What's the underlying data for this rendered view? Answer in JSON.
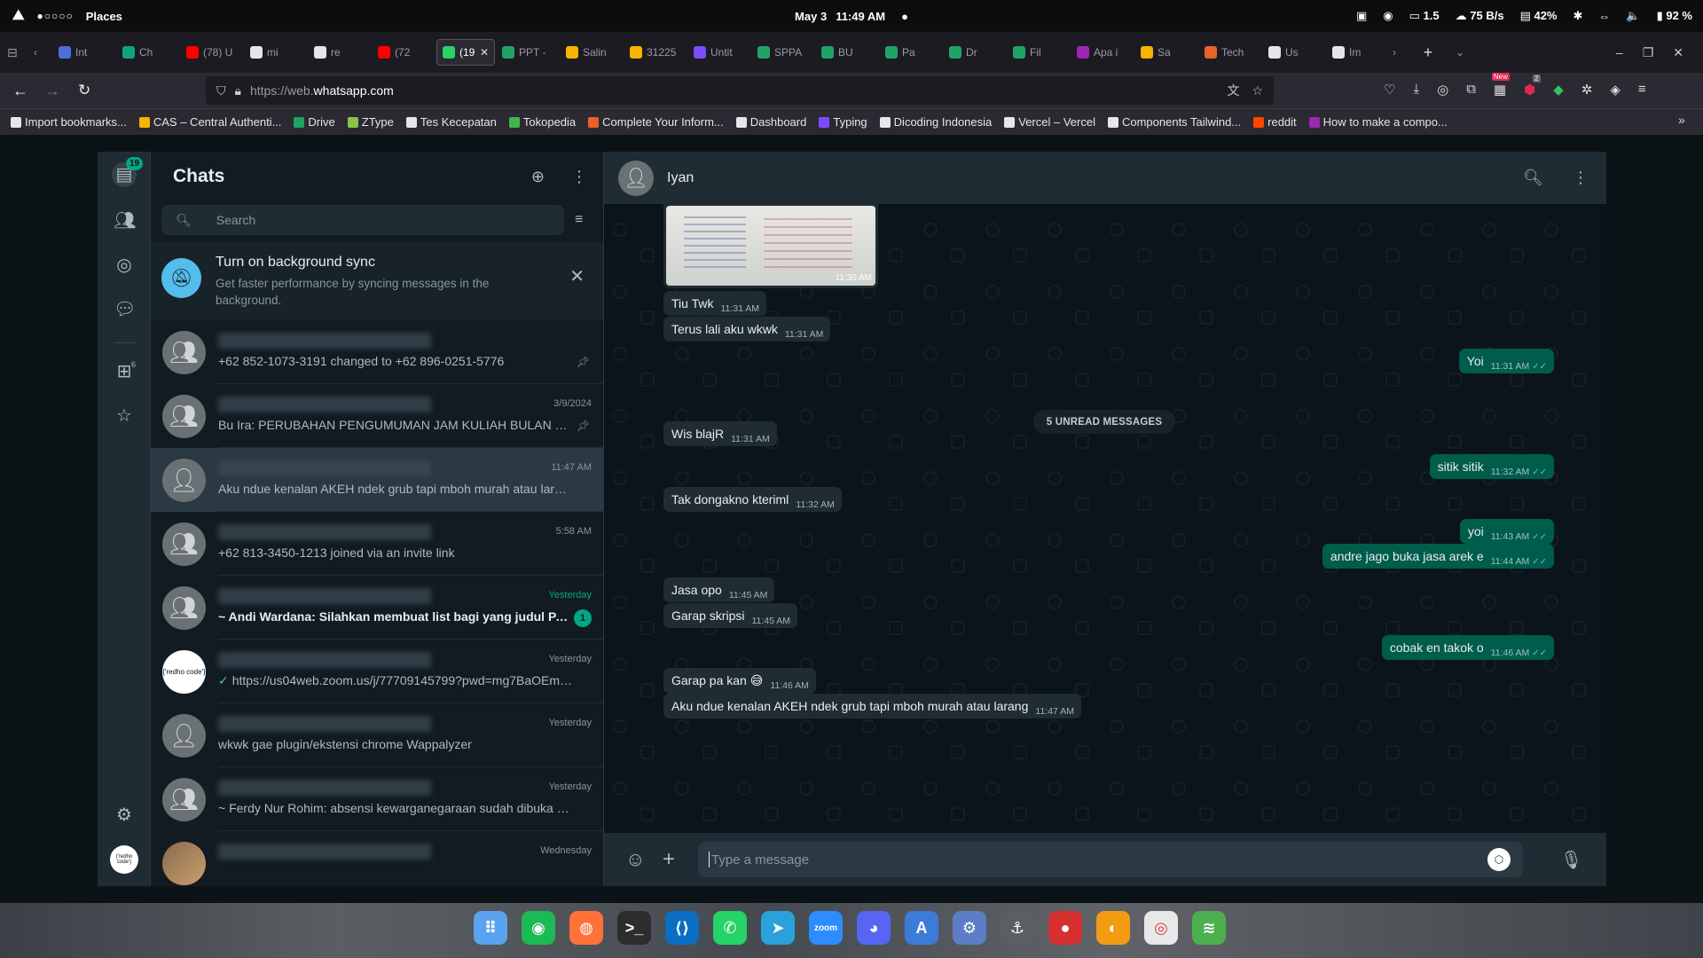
{
  "topbar": {
    "places": "Places",
    "date": "May 3",
    "time": "11:49 AM",
    "load": "1.5",
    "net": "75 B/s",
    "battery": "42%",
    "volume_level": "92 %"
  },
  "tabs": [
    {
      "label": "Int",
      "color": "#4a6fd8"
    },
    {
      "label": "Ch",
      "color": "#10a37f"
    },
    {
      "label": "(78) U",
      "color": "#ff0000"
    },
    {
      "label": "mi",
      "color": "#e6e6e6"
    },
    {
      "label": "re",
      "color": "#e6e6e6"
    },
    {
      "label": "(72",
      "color": "#ff0000"
    },
    {
      "label": "(19",
      "color": "#25d366"
    },
    {
      "label": "PPT -",
      "color": "#1fa463"
    },
    {
      "label": "Salin",
      "color": "#f4b400"
    },
    {
      "label": "31225",
      "color": "#f4b400"
    },
    {
      "label": "Untit",
      "color": "#7c4dff"
    },
    {
      "label": "SPPA",
      "color": "#1fa463"
    },
    {
      "label": "BU",
      "color": "#1fa463"
    },
    {
      "label": "Pa",
      "color": "#1fa463"
    },
    {
      "label": "Dr",
      "color": "#1fa463"
    },
    {
      "label": "Fil",
      "color": "#1fa463"
    },
    {
      "label": "Apa i",
      "color": "#9c27b0"
    },
    {
      "label": "Sa",
      "color": "#f4b400"
    },
    {
      "label": "Tech",
      "color": "#e8622a"
    },
    {
      "label": "Us",
      "color": "#e6e6e6"
    },
    {
      "label": "Im",
      "color": "#e6e6e6"
    }
  ],
  "url": {
    "prefix": "https://web.",
    "domain": "whatsapp.com",
    "badge_new": "New",
    "badge_count": "2"
  },
  "bookmarks": [
    {
      "label": "Import bookmarks...",
      "color": "#e6e6e6"
    },
    {
      "label": "CAS – Central Authenti...",
      "color": "#f4b400"
    },
    {
      "label": "Drive",
      "color": "#1fa463"
    },
    {
      "label": "ZType",
      "color": "#8bc34a"
    },
    {
      "label": "Tes Kecepatan",
      "color": "#e6e6e6"
    },
    {
      "label": "Tokopedia",
      "color": "#42b549"
    },
    {
      "label": "Complete Your Inform...",
      "color": "#e8622a"
    },
    {
      "label": "Dashboard",
      "color": "#e6e6e6"
    },
    {
      "label": "Typing",
      "color": "#7c4dff"
    },
    {
      "label": "Dicoding Indonesia",
      "color": "#e6e6e6"
    },
    {
      "label": "Vercel – Vercel",
      "color": "#e6e6e6"
    },
    {
      "label": "Components Tailwind...",
      "color": "#e6e6e6"
    },
    {
      "label": "reddit",
      "color": "#ff4500"
    },
    {
      "label": "How to make a compo...",
      "color": "#9c27b0"
    }
  ],
  "rail": {
    "chats_badge": "19",
    "communities_badge": "6"
  },
  "sidebar": {
    "title": "Chats",
    "search_placeholder": "Search",
    "sync": {
      "title": "Turn on background sync",
      "desc": "Get faster performance by syncing messages in the background."
    },
    "chats": [
      {
        "time": "",
        "msg": "+62 852-1073-3191 changed to +62 896-0251-5776",
        "avatar": "group"
      },
      {
        "time": "3/9/2024",
        "msg": "Bu Ira: PERUBAHAN PENGUMUMAN JAM KULIAH BULAN RAM...",
        "avatar": "group"
      },
      {
        "time": "11:47 AM",
        "msg": "Aku ndue kenalan AKEH ndek grub tapi mboh murah atau larang",
        "avatar": "person"
      },
      {
        "time": "5:58 AM",
        "msg": "+62 813-3450-1213 joined via an invite link",
        "avatar": "group"
      },
      {
        "time": "Yesterday",
        "msg": "~ Andi Wardana: Silahkan membuat list bagi yang judul PA s...",
        "avatar": "group",
        "unread": "1"
      },
      {
        "time": "Yesterday",
        "msg": "https://us04web.zoom.us/j/77709145799?pwd=mg7BaOEmXD...",
        "avatar": "logo",
        "logo_text": "{'redho code'}"
      },
      {
        "time": "Yesterday",
        "msg": "wkwk gae plugin/ekstensi chrome  Wappalyzer",
        "avatar": "person"
      },
      {
        "time": "Yesterday",
        "msg": "~ Ferdy Nur Rohim: absensi kewarganegaraan sudah dibuka ya t...",
        "avatar": "group"
      },
      {
        "time": "Wednesday",
        "msg": "",
        "avatar": "photo"
      }
    ]
  },
  "chat": {
    "name": "Iyan",
    "unread_divider": "5 UNREAD MESSAGES",
    "image_time": "11:30 AM",
    "compose_placeholder": "Type a message",
    "messages": [
      {
        "dir": "in",
        "text": "Tiu Twk",
        "time": "11:31 AM"
      },
      {
        "dir": "in",
        "text": "Terus lali aku wkwk",
        "time": "11:31 AM"
      },
      {
        "dir": "out",
        "text": "Yoi",
        "time": "11:31 AM"
      },
      {
        "dir": "in",
        "text": "Wis blajR",
        "time": "11:31 AM"
      },
      {
        "dir": "out",
        "text": "sitik sitik",
        "time": "11:32 AM"
      },
      {
        "dir": "in",
        "text": "Tak dongakno kteriml",
        "time": "11:32 AM"
      },
      {
        "dir": "out",
        "text": "yoi",
        "time": "11:43 AM"
      },
      {
        "dir": "out",
        "text": "andre jago buka jasa arek e",
        "time": "11:44 AM"
      },
      {
        "dir": "in",
        "text": "Jasa opo",
        "time": "11:45 AM"
      },
      {
        "dir": "in",
        "text": "Garap skripsi",
        "time": "11:45 AM"
      },
      {
        "dir": "out",
        "text": "cobak en takok o",
        "time": "11:46 AM"
      },
      {
        "dir": "in",
        "text": "Garap pa kan 😅",
        "time": "11:46 AM"
      },
      {
        "dir": "in",
        "text": "Aku ndue kenalan AKEH ndek grub tapi mboh murah atau larang",
        "time": "11:47 AM"
      }
    ]
  },
  "dock": [
    "apps",
    "spotify",
    "firefox",
    "terminal",
    "vscode",
    "whatsapp",
    "telegram",
    "zoom",
    "discord",
    "appstore",
    "tweaks",
    "settings",
    "recorder",
    "colors",
    "chrome",
    "layers"
  ],
  "dock_zoom_label": "zoom"
}
